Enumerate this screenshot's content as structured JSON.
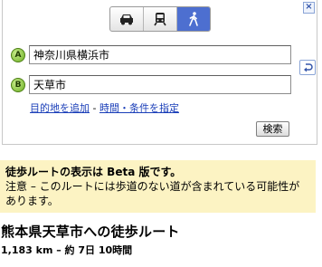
{
  "panel": {
    "close_label": "×",
    "modes": [
      {
        "name": "car",
        "active": false
      },
      {
        "name": "train",
        "active": false
      },
      {
        "name": "walk",
        "active": true
      }
    ],
    "origin": {
      "marker": "A",
      "value": "神奈川県横浜市"
    },
    "destination": {
      "marker": "B",
      "value": "天草市"
    },
    "links": {
      "add_destination": "目的地を追加",
      "separator": " - ",
      "time_conditions": "時間・条件を指定"
    },
    "search_label": "検索"
  },
  "notice": {
    "title": "徒歩ルートの表示は Beta 版です。",
    "body": "注意 – このルートには歩道のない道が含まれている可能性があります。"
  },
  "result": {
    "title": "熊本県天草市への徒歩ルート",
    "distance_time": "1,183 km – 約 7日 10時間"
  },
  "colors": {
    "active_mode": "#4d6fd0",
    "link": "#1a3eb8",
    "notice_bg": "#fcf3c3",
    "marker_green": "#6db023"
  }
}
